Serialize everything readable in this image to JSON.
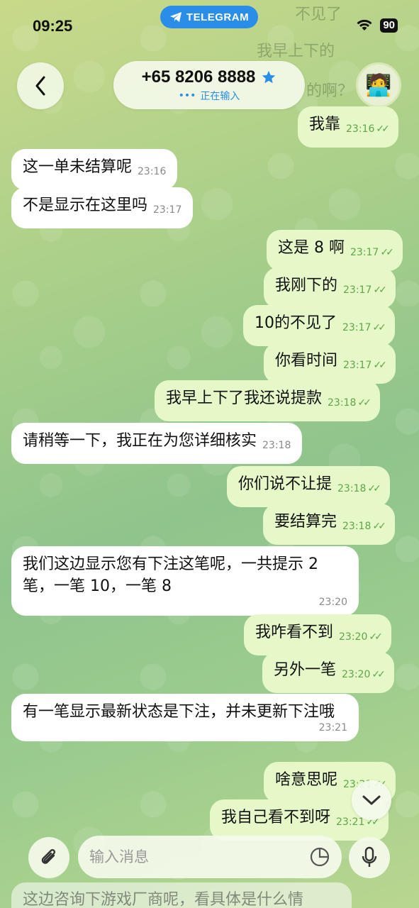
{
  "status_bar": {
    "time": "09:25",
    "battery": "90"
  },
  "app_badge": "TELEGRAM",
  "header": {
    "contact_name": "+65 8206 8888",
    "status": "正在输入"
  },
  "background_ghost": [
    "不见了",
    "我早上下的",
    "的啊？"
  ],
  "messages": [
    {
      "id": "m1",
      "dir": "out",
      "text": "我靠",
      "time": "23:16"
    },
    {
      "id": "m2",
      "dir": "in",
      "text": "这一单未结算呢",
      "time": "23:16"
    },
    {
      "id": "m3",
      "dir": "in",
      "text": "不是显示在这里吗",
      "time": "23:17"
    },
    {
      "id": "m4",
      "dir": "out",
      "text": "这是 8 啊",
      "time": "23:17"
    },
    {
      "id": "m5",
      "dir": "out",
      "text": "我刚下的",
      "time": "23:17"
    },
    {
      "id": "m6",
      "dir": "out",
      "text": "10的不见了",
      "time": "23:17"
    },
    {
      "id": "m7",
      "dir": "out",
      "text": "你看时间",
      "time": "23:17"
    },
    {
      "id": "m8",
      "dir": "out",
      "text": "我早上下了我还说提款",
      "time": "23:18"
    },
    {
      "id": "m9",
      "dir": "in",
      "text": "请稍等一下，我正在为您详细核实",
      "time": "23:18"
    },
    {
      "id": "m10",
      "dir": "out",
      "text": "你们说不让提",
      "time": "23:18"
    },
    {
      "id": "m11",
      "dir": "out",
      "text": "要结算完",
      "time": "23:18"
    },
    {
      "id": "m12",
      "dir": "in",
      "text": "我们这边显示您有下注这笔呢，一共提示 2 笔，一笔 10，一笔 8",
      "time": "23:20"
    },
    {
      "id": "m13",
      "dir": "out",
      "text": "我咋看不到",
      "time": "23:20"
    },
    {
      "id": "m14",
      "dir": "out",
      "text": "另外一笔",
      "time": "23:20"
    },
    {
      "id": "m15",
      "dir": "in",
      "text": "有一笔显示最新状态是下注，并未更新下注哦",
      "time": "23:21"
    },
    {
      "id": "m16",
      "dir": "out",
      "text": "啥意思呢",
      "time": "23:21"
    },
    {
      "id": "m17",
      "dir": "out",
      "text": "我自己看不到呀",
      "time": "23:21"
    }
  ],
  "composer": {
    "placeholder": "输入消息"
  },
  "peek_message": "这边咨询下游戏厂商呢，看具体是什么情",
  "colors": {
    "accent": "#2a8de8",
    "outgoing_bubble": "#e6f8c8",
    "incoming_bubble": "#ffffff"
  }
}
